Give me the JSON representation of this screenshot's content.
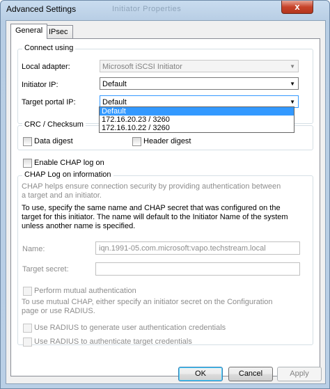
{
  "window": {
    "title": "Advanced Settings",
    "title_ghost": "Initiator Properties",
    "close_glyph": "x"
  },
  "tabs": [
    {
      "label": "General"
    },
    {
      "label": "IPsec"
    }
  ],
  "connect_using": {
    "group_label": "Connect using",
    "local_adapter": {
      "label": "Local adapter:",
      "value": "Microsoft iSCSI Initiator"
    },
    "initiator_ip": {
      "label": "Initiator IP:",
      "value": "Default"
    },
    "target_portal_ip": {
      "label": "Target portal IP:",
      "value": "Default"
    },
    "dropdown_options": [
      "Default",
      "172.16.20.23 / 3260",
      "172.16.10.22 / 3260"
    ]
  },
  "crc": {
    "group_label": "CRC / Checksum",
    "data_digest": "Data digest",
    "header_digest": "Header digest"
  },
  "chap": {
    "enable_label": "Enable CHAP log on",
    "group_label": "CHAP Log on information",
    "desc1": "CHAP helps ensure connection security by providing authentication between a target and an initiator.",
    "desc2": "To use, specify the same name and CHAP secret that was configured on the target for this initiator. The name will default to the Initiator Name of the system unless another name is specified.",
    "name_label": "Name:",
    "name_value": "iqn.1991-05.com.microsoft:vapo.techstream.local",
    "secret_label": "Target secret:",
    "secret_value": "",
    "mutual_label": "Perform mutual authentication",
    "mutual_desc": "To use mutual CHAP, either specify an initiator secret on the Configuration page or use RADIUS.",
    "radius_user": "Use RADIUS to generate user authentication credentials",
    "radius_target": "Use RADIUS to authenticate target credentials"
  },
  "buttons": {
    "ok": "OK",
    "cancel": "Cancel",
    "apply": "Apply"
  }
}
